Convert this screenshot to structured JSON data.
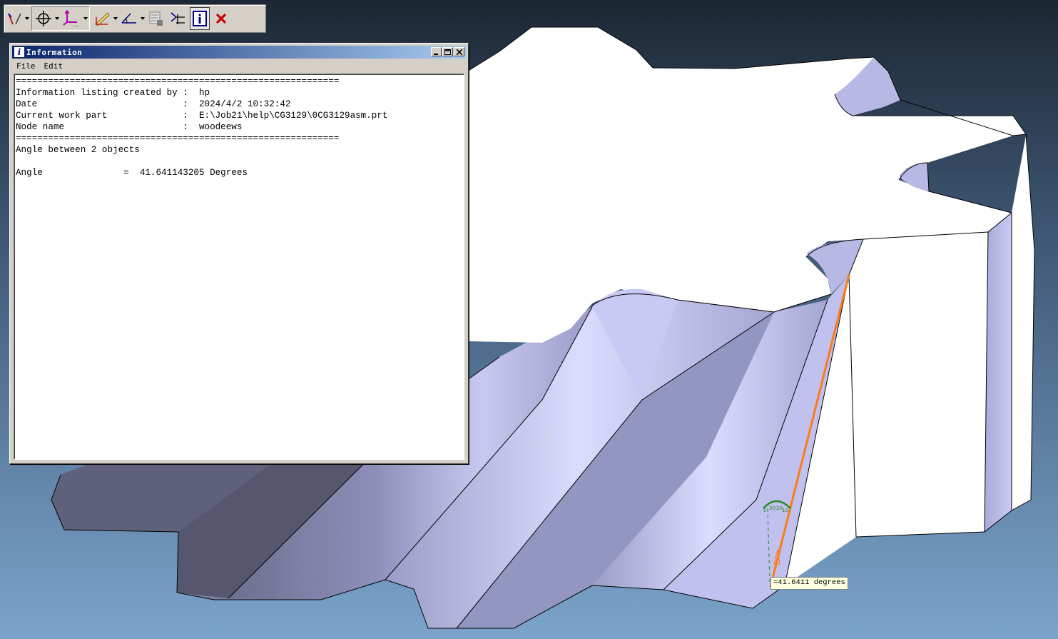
{
  "info_window": {
    "title": "Information",
    "menu": [
      "File",
      "Edit"
    ],
    "lines": [
      "============================================================",
      "Information listing created by :  hp",
      "Date                           :  2024/4/2 10:32:42",
      "Current work part              :  E:\\Job21\\help\\CG3129\\0CG3129asm.prt",
      "Node name                      :  woodeews",
      "============================================================",
      "Angle between 2 objects",
      "",
      "Angle               =  41.641143205 Degrees"
    ]
  },
  "viewport": {
    "angle_label": "=41.6411 degrees",
    "protractor_ticks": [
      "0",
      "30",
      "20",
      "10"
    ]
  },
  "toolbar": {
    "icons": [
      "line-icon",
      "point-constructor-icon",
      "csys-icon",
      "measure-distance-icon",
      "measure-angle-icon",
      "info-point-icon",
      "measure-surface-icon",
      "information-icon",
      "close-icon"
    ]
  },
  "colors": {
    "background_top": "#1c2733",
    "background_bottom": "#7ba4cc",
    "model_face_white": "#ffffff",
    "model_face_shade": "#a7a8d3",
    "measure_line": "#ff7a14",
    "protractor": "#2a8a2a",
    "titlebar": "#0a246a",
    "close_red": "#cc0000"
  }
}
